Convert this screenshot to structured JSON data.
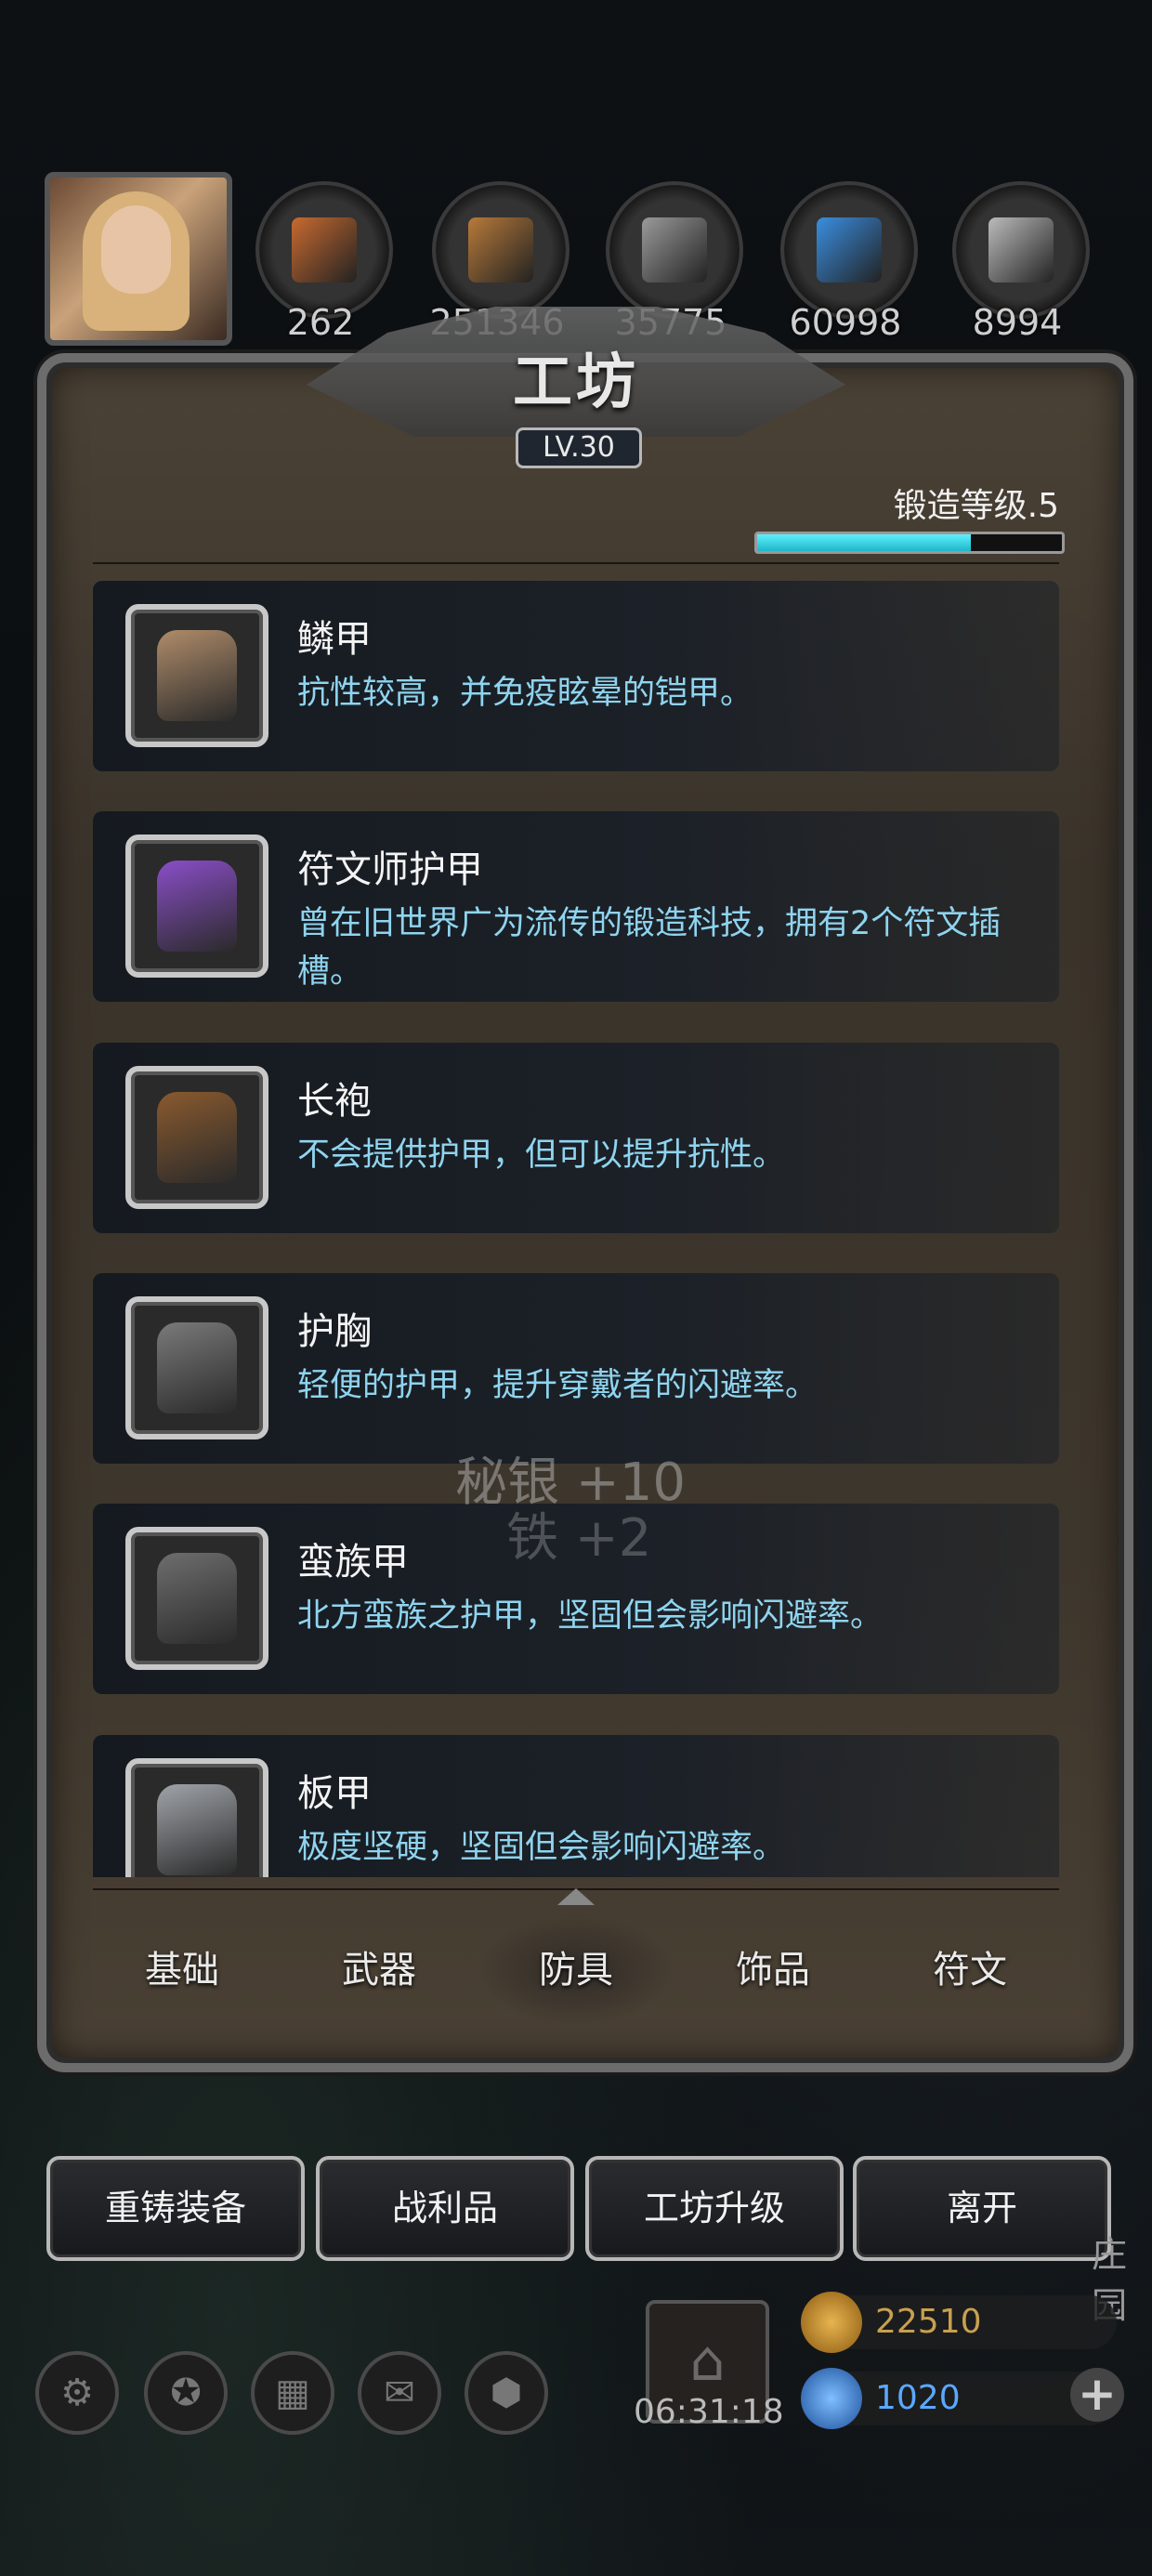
{
  "resources": [
    {
      "name": "gem-orange-icon",
      "value": "262",
      "color": "#c86a30"
    },
    {
      "name": "wood-icon",
      "value": "251346",
      "color": "#b77a3a"
    },
    {
      "name": "iron-icon",
      "value": "35775",
      "color": "#9a9a9a"
    },
    {
      "name": "crystal-icon",
      "value": "60998",
      "color": "#3a8ee0"
    },
    {
      "name": "steel-icon",
      "value": "8994",
      "color": "#bbbbbb"
    }
  ],
  "panel": {
    "title": "工坊",
    "level": "LV.30",
    "forge_label": "锻造等级.5",
    "forge_progress": 0.7
  },
  "items": [
    {
      "name": "鳞甲",
      "desc": "抗性较高，并免疫眩晕的铠甲。",
      "color": "#b08c6a"
    },
    {
      "name": "符文师护甲",
      "desc": "曾在旧世界广为流传的锻造科技，拥有2个符文插槽。",
      "color": "#8a4ec8"
    },
    {
      "name": "长袍",
      "desc": "不会提供护甲，但可以提升抗性。",
      "color": "#8a5a2e"
    },
    {
      "name": "护胸",
      "desc": "轻便的护甲，提升穿戴者的闪避率。",
      "color": "#7a7a7a"
    },
    {
      "name": "蛮族甲",
      "desc": "北方蛮族之护甲，坚固但会影响闪避率。",
      "color": "#6e6e6e"
    },
    {
      "name": "板甲",
      "desc": "极度坚硬，坚固但会影响闪避率。",
      "color": "#a0a4aa"
    }
  ],
  "floating": {
    "line1": "秘银 +10",
    "line2": "铁 +2"
  },
  "tabs": [
    "基础",
    "武器",
    "防具",
    "饰品",
    "符文"
  ],
  "active_tab": "防具",
  "buttons": {
    "reforge": "重铸装备",
    "loot": "战利品",
    "upgrade": "工坊升级",
    "leave": "离开"
  },
  "timer": "06:31:18",
  "currency": {
    "gold": "22510",
    "gems": "1020"
  },
  "side_text": "庄园"
}
